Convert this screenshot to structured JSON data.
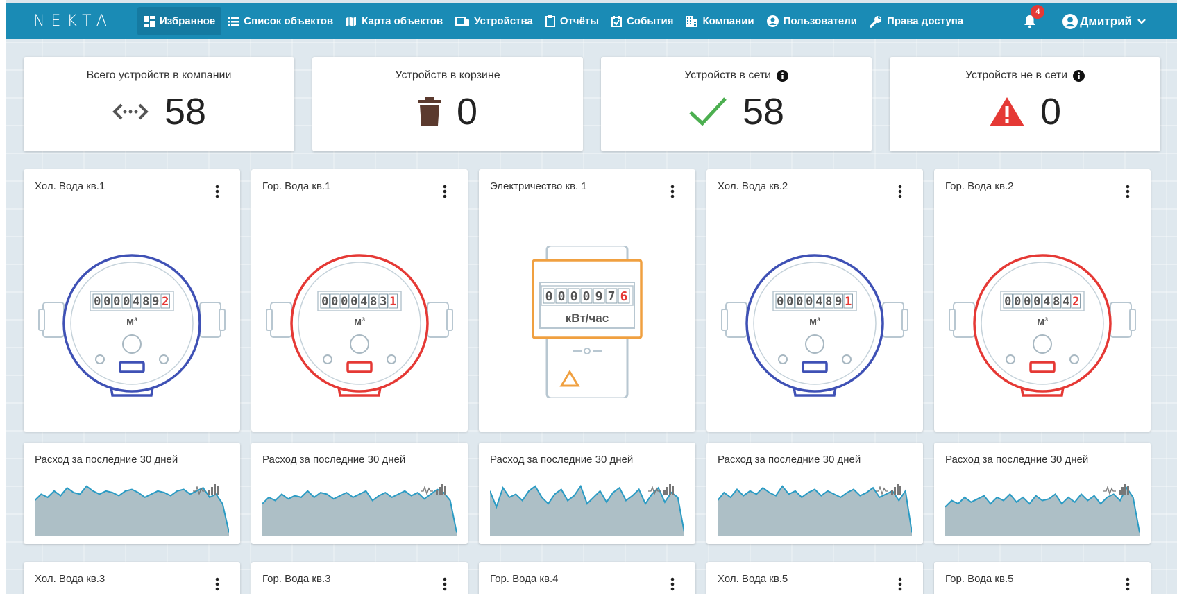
{
  "app": {
    "logo": "NEKTA",
    "nav": [
      {
        "label": "Избранное",
        "icon": "dashboard-icon",
        "active": true
      },
      {
        "label": "Список объектов",
        "icon": "list-icon"
      },
      {
        "label": "Карта объектов",
        "icon": "map-icon"
      },
      {
        "label": "Устройства",
        "icon": "devices-icon"
      },
      {
        "label": "Отчёты",
        "icon": "clipboard-icon"
      },
      {
        "label": "События",
        "icon": "calendar-check-icon"
      },
      {
        "label": "Компании",
        "icon": "building-icon"
      },
      {
        "label": "Пользователи",
        "icon": "user-circle-icon"
      },
      {
        "label": "Права доступа",
        "icon": "wrench-icon"
      }
    ],
    "notifications_count": "4",
    "user_name": "Дмитрий",
    "accent_color": "#1a8bb5"
  },
  "stats": [
    {
      "title": "Всего устройств в компании",
      "value": "58",
      "icon": "connection-arrows-icon",
      "info": false
    },
    {
      "title": "Устройств в корзине",
      "value": "0",
      "icon": "trash-icon",
      "info": false
    },
    {
      "title": "Устройств в сети",
      "value": "58",
      "icon": "check-icon",
      "info": true
    },
    {
      "title": "Устройств не в сети",
      "value": "0",
      "icon": "warning-icon",
      "info": true
    }
  ],
  "devices": [
    {
      "title": "Хол. Вода кв.1",
      "type": "water",
      "color": "#3f51b5",
      "reading_black": "0000489",
      "reading_red": "2",
      "unit": "м³"
    },
    {
      "title": "Гор. Вода кв.1",
      "type": "water",
      "color": "#e53935",
      "reading_black": "0000483",
      "reading_red": "1",
      "unit": "м³"
    },
    {
      "title": "Электричество кв. 1",
      "type": "electric",
      "color": "#f0a040",
      "reading_black": "000097",
      "reading_red": "6",
      "unit": "кВт/час"
    },
    {
      "title": "Хол. Вода кв.2",
      "type": "water",
      "color": "#3f51b5",
      "reading_black": "0000489",
      "reading_red": "1",
      "unit": "м³"
    },
    {
      "title": "Гор. Вода кв.2",
      "type": "water",
      "color": "#e53935",
      "reading_black": "0000484",
      "reading_red": "2",
      "unit": "м³"
    }
  ],
  "consumption": {
    "title": "Расход за последние 30 дней",
    "series": [
      [
        22,
        26,
        24,
        28,
        25,
        30,
        27,
        26,
        31,
        28,
        26,
        28,
        27,
        25,
        28,
        29,
        27,
        24,
        26,
        28,
        27,
        25,
        28,
        29,
        26,
        28,
        30,
        24,
        26,
        20,
        2
      ],
      [
        20,
        24,
        22,
        26,
        23,
        25,
        24,
        28,
        24,
        27,
        26,
        23,
        25,
        27,
        24,
        26,
        28,
        22,
        25,
        27,
        24,
        26,
        28,
        25,
        27,
        23,
        26,
        29,
        27,
        22,
        2
      ],
      [
        28,
        18,
        30,
        24,
        26,
        22,
        28,
        31,
        24,
        20,
        26,
        29,
        22,
        25,
        31,
        20,
        24,
        28,
        21,
        27,
        30,
        22,
        25,
        29,
        20,
        26,
        30,
        21,
        27,
        24,
        2
      ],
      [
        22,
        27,
        24,
        29,
        25,
        28,
        26,
        30,
        27,
        25,
        31,
        26,
        28,
        24,
        27,
        29,
        25,
        28,
        26,
        24,
        27,
        29,
        25,
        27,
        30,
        24,
        26,
        28,
        22,
        28,
        2
      ],
      [
        18,
        22,
        20,
        24,
        21,
        23,
        25,
        20,
        24,
        22,
        26,
        21,
        24,
        20,
        25,
        22,
        23,
        26,
        20,
        24,
        21,
        26,
        22,
        25,
        20,
        24,
        26,
        22,
        30,
        24,
        2
      ]
    ]
  },
  "row3_titles": [
    "Хол. Вода кв.3",
    "Гор. Вода кв.3",
    "Гор. Вода кв.4",
    "Хол. Вода кв.5",
    "Гор. Вода кв.5"
  ]
}
